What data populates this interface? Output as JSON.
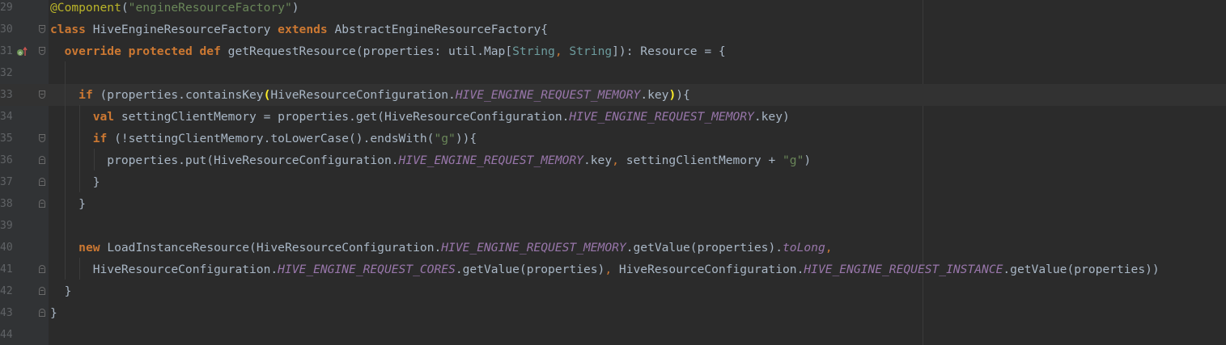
{
  "editor": {
    "lines": [
      {
        "n": "29",
        "t": [
          [
            "ann",
            "@Component"
          ],
          [
            "",
            "("
          ],
          [
            "str",
            "\"engineResourceFactory\""
          ],
          [
            "",
            ")"
          ]
        ]
      },
      {
        "n": "30",
        "t": [
          [
            "kw",
            "class "
          ],
          [
            "",
            "HiveEngineResourceFactory "
          ],
          [
            "kw",
            "extends "
          ],
          [
            "",
            "AbstractEngineResourceFactory{"
          ]
        ]
      },
      {
        "n": "31",
        "t": [
          [
            "",
            "  "
          ],
          [
            "kw",
            "override protected def "
          ],
          [
            "",
            "getRequestResource(properties: util.Map["
          ],
          [
            "typ",
            "String"
          ],
          [
            "cm",
            ", "
          ],
          [
            "typ",
            "String"
          ],
          [
            "",
            "]): Resource = {"
          ]
        ]
      },
      {
        "n": "32",
        "t": []
      },
      {
        "n": "33",
        "t": [
          [
            "",
            "    "
          ],
          [
            "kw",
            "if "
          ],
          [
            "",
            "(properties.containsKey"
          ],
          [
            "yb",
            "("
          ],
          [
            "",
            "HiveResourceConfiguration."
          ],
          [
            "cst",
            "HIVE_ENGINE_REQUEST_MEMORY"
          ],
          [
            "",
            ".key"
          ],
          [
            "yb",
            ")"
          ],
          [
            "",
            "){"
          ]
        ]
      },
      {
        "n": "34",
        "t": [
          [
            "",
            "      "
          ],
          [
            "kw",
            "val "
          ],
          [
            "",
            "settingClientMemory = properties.get(HiveResourceConfiguration."
          ],
          [
            "cst",
            "HIVE_ENGINE_REQUEST_MEMORY"
          ],
          [
            "",
            ".key)"
          ]
        ]
      },
      {
        "n": "35",
        "t": [
          [
            "",
            "      "
          ],
          [
            "kw",
            "if "
          ],
          [
            "",
            "(!settingClientMemory.toLowerCase().endsWith("
          ],
          [
            "str",
            "\"g\""
          ],
          [
            "",
            ")){"
          ]
        ]
      },
      {
        "n": "36",
        "t": [
          [
            "",
            "        properties.put(HiveResourceConfiguration."
          ],
          [
            "cst",
            "HIVE_ENGINE_REQUEST_MEMORY"
          ],
          [
            "",
            ".key"
          ],
          [
            "cm",
            ", "
          ],
          [
            "",
            "settingClientMemory + "
          ],
          [
            "str",
            "\"g\""
          ],
          [
            "",
            ")"
          ]
        ]
      },
      {
        "n": "37",
        "t": [
          [
            "",
            "      }"
          ]
        ]
      },
      {
        "n": "38",
        "t": [
          [
            "",
            "    }"
          ]
        ]
      },
      {
        "n": "39",
        "t": []
      },
      {
        "n": "40",
        "t": [
          [
            "",
            "    "
          ],
          [
            "kw",
            "new "
          ],
          [
            "",
            "LoadInstanceResource(HiveResourceConfiguration."
          ],
          [
            "cst",
            "HIVE_ENGINE_REQUEST_MEMORY"
          ],
          [
            "",
            ".getValue(properties)."
          ],
          [
            "it",
            "toLong"
          ],
          [
            "cm",
            ","
          ]
        ]
      },
      {
        "n": "41",
        "t": [
          [
            "",
            "      HiveResourceConfiguration."
          ],
          [
            "cst",
            "HIVE_ENGINE_REQUEST_CORES"
          ],
          [
            "",
            ".getValue(properties)"
          ],
          [
            "cm",
            ", "
          ],
          [
            "",
            "HiveResourceConfiguration."
          ],
          [
            "cst",
            "HIVE_ENGINE_REQUEST_INSTANCE"
          ],
          [
            "",
            ".getValue(properties))"
          ]
        ]
      },
      {
        "n": "42",
        "t": [
          [
            "",
            "  }"
          ]
        ]
      },
      {
        "n": "43",
        "t": [
          [
            "",
            "}"
          ]
        ]
      },
      {
        "n": "44",
        "t": []
      }
    ]
  }
}
